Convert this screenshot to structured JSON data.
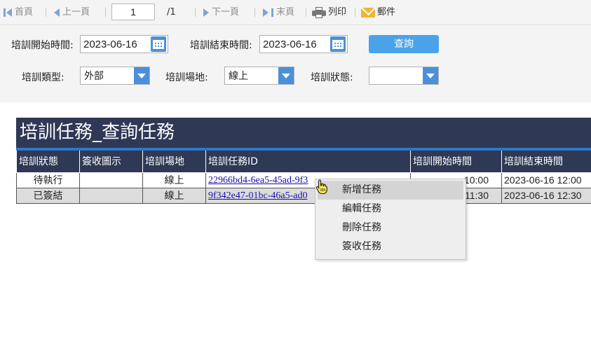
{
  "toolbar": {
    "first": "首頁",
    "prev": "上一頁",
    "page_value": "1",
    "page_total": "/1",
    "next": "下一頁",
    "last": "末頁",
    "print": "列印",
    "mail": "郵件"
  },
  "filters": {
    "start_label": "培訓開始時間:",
    "start_value": "2023-06-16",
    "end_label": "培訓結束時間:",
    "end_value": "2023-06-16",
    "query_label": "查詢",
    "type_label": "培訓類型:",
    "type_value": "外部",
    "venue_label": "培訓場地:",
    "venue_value": "線上",
    "status_label": "培訓狀態:",
    "status_value": ""
  },
  "report": {
    "title": "培訓任務_查詢任務",
    "columns": [
      "培訓狀態",
      "簽收圖示",
      "培訓場地",
      "培訓任務ID",
      "培訓開始時間",
      "培訓結束時間"
    ],
    "rows": [
      {
        "status": "待執行",
        "sign": "",
        "venue": "線上",
        "id": "22966bd4-6ea5-45ad-9f3",
        "start": "10:00",
        "end": "2023-06-16 12:00"
      },
      {
        "status": "已簽結",
        "sign": "",
        "venue": "線上",
        "id": "9f342e47-01bc-46a5-ad0",
        "start": "11:30",
        "end": "2023-06-16 12:30"
      }
    ]
  },
  "context_menu": {
    "items": [
      "新增任務",
      "編輯任務",
      "刪除任務",
      "簽收任務"
    ]
  },
  "colors": {
    "header_bg": "#2f3855",
    "accent": "#4a90d9",
    "rule": "#2e78c8"
  }
}
